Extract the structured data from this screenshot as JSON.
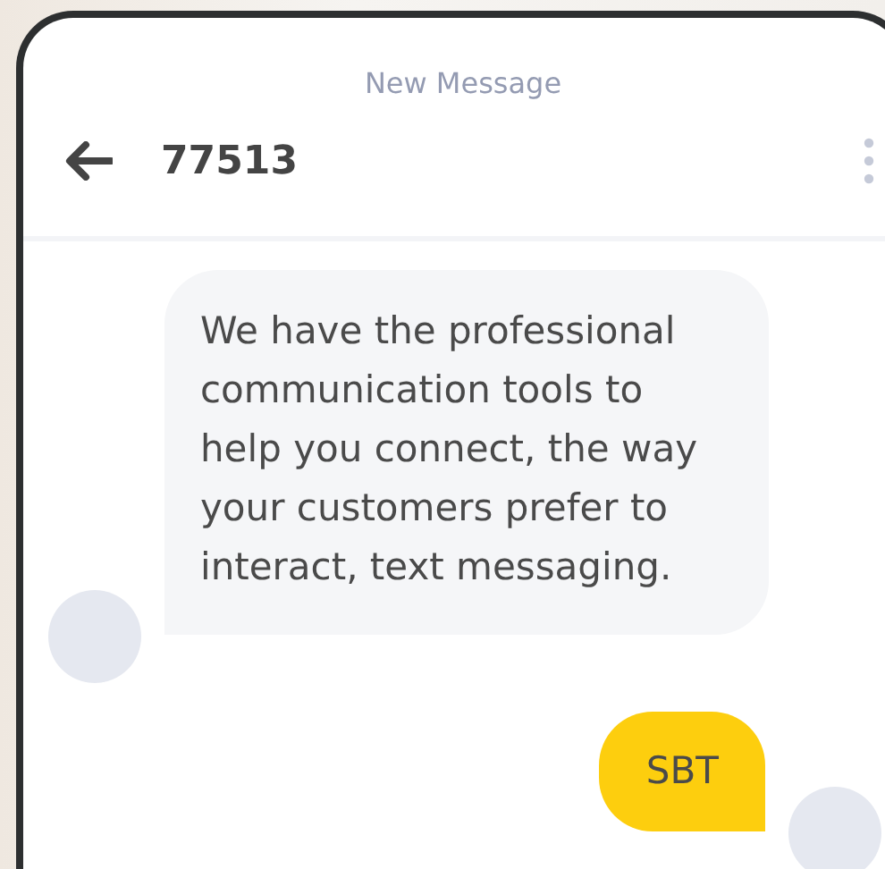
{
  "header": {
    "title": "New Message",
    "contact": "77513"
  },
  "messages": [
    {
      "kind": "incoming",
      "text": "We have the professional communication tools to help you connect, the way your customers prefer to interact, text messaging."
    },
    {
      "kind": "outgoing",
      "text": "SBT"
    }
  ]
}
